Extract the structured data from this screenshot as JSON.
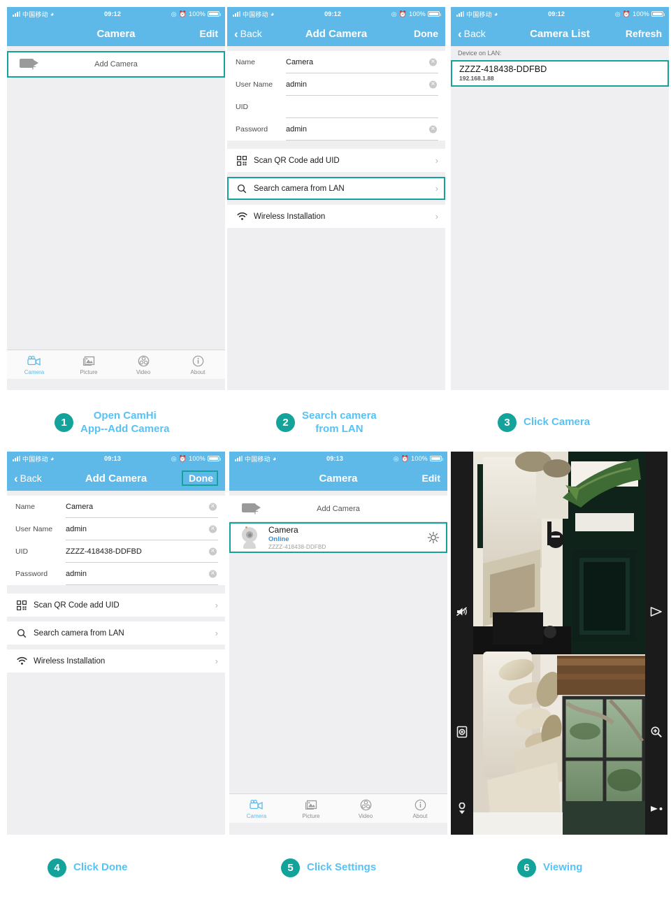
{
  "meta": {
    "accent_teal": "#14A39A",
    "accent_blue": "#57C2F5",
    "nav_blue": "#5FB9E8",
    "body_gray": "#EFEEF1"
  },
  "status_bar": {
    "carrier": "中国移动",
    "time_0912": "09:12",
    "time_0913": "09:13",
    "battery": "100%",
    "wifi_icon": "wifi-icon",
    "signal_icon": "signal-bars-icon",
    "location_icon": "location-icon",
    "alarm_icon": "alarm-icon",
    "battery_icon": "battery-icon"
  },
  "panel1": {
    "nav": {
      "title": "Camera",
      "right": "Edit"
    },
    "add_camera": {
      "label": "Add Camera",
      "icon": "camera-plus-icon"
    },
    "tabs": [
      {
        "label": "Camera",
        "icon": "video-camera-icon",
        "active": true
      },
      {
        "label": "Picture",
        "icon": "picture-icon",
        "active": false
      },
      {
        "label": "Video",
        "icon": "video-reel-icon",
        "active": false
      },
      {
        "label": "About",
        "icon": "info-icon",
        "active": false
      }
    ]
  },
  "panel2": {
    "nav": {
      "left": "Back",
      "title": "Add Camera",
      "right": "Done"
    },
    "fields": [
      {
        "label": "Name",
        "value": "Camera",
        "clear": true
      },
      {
        "label": "User Name",
        "value": "admin",
        "clear": true
      },
      {
        "label": "UID",
        "value": "",
        "clear": false
      },
      {
        "label": "Password",
        "value": "admin",
        "clear": true
      }
    ],
    "menu": [
      {
        "label": "Scan QR Code add UID",
        "icon": "qr-code-icon",
        "highlighted": false
      },
      {
        "label": "Search camera from LAN",
        "icon": "search-icon",
        "highlighted": true
      },
      {
        "label": "Wireless Installation",
        "icon": "wifi-icon",
        "highlighted": false
      }
    ]
  },
  "panel3": {
    "nav": {
      "left": "Back",
      "title": "Camera List",
      "right": "Refresh"
    },
    "section_header": "Device on LAN:",
    "device": {
      "uid": "ZZZZ-418438-DDFBD",
      "ip": "192.168.1.88",
      "highlighted": true
    }
  },
  "panel4": {
    "nav": {
      "left": "Back",
      "title": "Add Camera",
      "right": "Done",
      "right_highlighted": true
    },
    "fields": [
      {
        "label": "Name",
        "value": "Camera",
        "clear": true
      },
      {
        "label": "User Name",
        "value": "admin",
        "clear": true
      },
      {
        "label": "UID",
        "value": "ZZZZ-418438-DDFBD",
        "clear": true
      },
      {
        "label": "Password",
        "value": "admin",
        "clear": true
      }
    ],
    "menu": [
      {
        "label": "Scan QR Code add UID",
        "icon": "qr-code-icon"
      },
      {
        "label": "Search camera from LAN",
        "icon": "search-icon"
      },
      {
        "label": "Wireless Installation",
        "icon": "wifi-icon"
      }
    ]
  },
  "panel5": {
    "nav": {
      "title": "Camera",
      "right": "Edit"
    },
    "add_camera": {
      "label": "Add Camera",
      "icon": "camera-plus-icon"
    },
    "camera": {
      "name": "Camera",
      "status": "Online",
      "uid": "ZZZZ-418438-DDFBD",
      "settings_icon": "gear-icon",
      "highlighted": true
    },
    "tabs": [
      {
        "label": "Camera",
        "icon": "video-camera-icon",
        "active": true
      },
      {
        "label": "Picture",
        "icon": "picture-icon",
        "active": false
      },
      {
        "label": "Video",
        "icon": "video-reel-icon",
        "active": false
      },
      {
        "label": "About",
        "icon": "info-icon",
        "active": false
      }
    ]
  },
  "panel6": {
    "controls_left": [
      {
        "name": "mute-speaker-icon"
      },
      {
        "name": "snapshot-icon"
      },
      {
        "name": "microphone-icon"
      },
      {
        "name": "exit-fullscreen-icon"
      }
    ],
    "controls_right": [
      {
        "name": "play-icon"
      },
      {
        "name": "zoom-in-icon"
      },
      {
        "name": "record-icon"
      },
      {
        "name": "rotate-icon"
      }
    ]
  },
  "steps": [
    {
      "number": "1",
      "line1": "Open CamHi",
      "line2": "App--Add Camera"
    },
    {
      "number": "2",
      "line1": "Search camera",
      "line2": "from LAN"
    },
    {
      "number": "3",
      "line1": "Click Camera",
      "line2": ""
    },
    {
      "number": "4",
      "line1": "Click Done",
      "line2": ""
    },
    {
      "number": "5",
      "line1": "Click Settings",
      "line2": ""
    },
    {
      "number": "6",
      "line1": "Viewing",
      "line2": ""
    }
  ]
}
